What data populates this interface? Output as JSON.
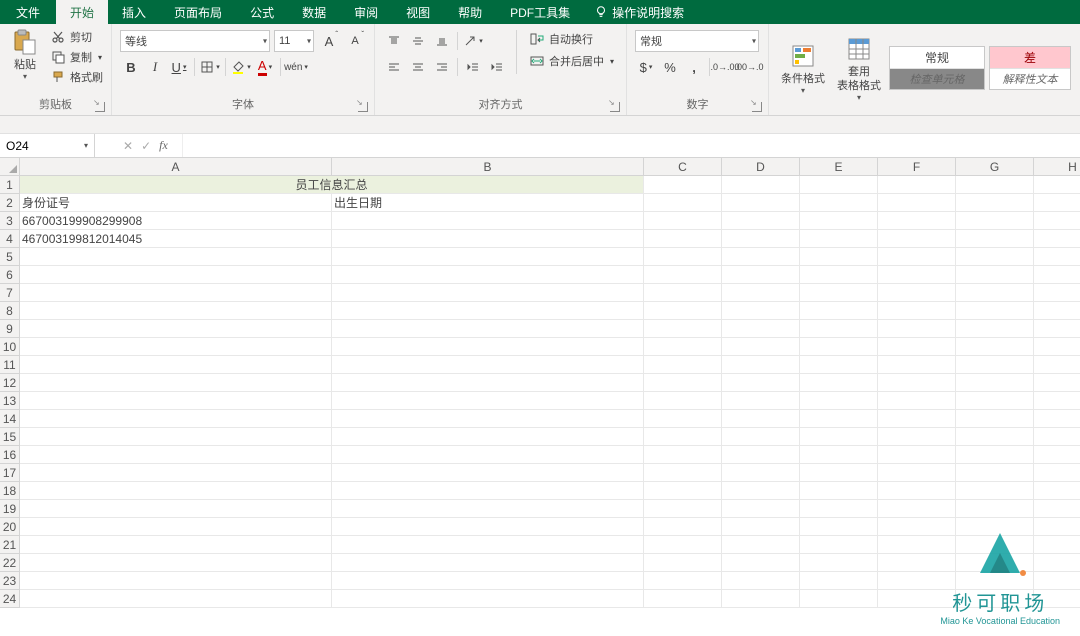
{
  "tabs": {
    "file": "文件",
    "home": "开始",
    "insert": "插入",
    "layout": "页面布局",
    "formulas": "公式",
    "data": "数据",
    "review": "审阅",
    "view": "视图",
    "help": "帮助",
    "pdf": "PDF工具集",
    "tell": "操作说明搜索"
  },
  "ribbon": {
    "clipboard": {
      "paste": "粘贴",
      "cut": "剪切",
      "copy": "复制",
      "painter": "格式刷",
      "label": "剪贴板"
    },
    "font": {
      "name": "等线",
      "size": "11",
      "label": "字体"
    },
    "align": {
      "wrap": "自动换行",
      "merge": "合并后居中",
      "label": "对齐方式"
    },
    "number": {
      "format": "常规",
      "label": "数字"
    },
    "styles": {
      "cond": "条件格式",
      "table": "套用\n表格格式",
      "normal": "常规",
      "check": "检查单元格",
      "bad": "差",
      "explain": "解释性文本"
    }
  },
  "fxbar": {
    "namebox": "O24"
  },
  "sheet": {
    "cols": [
      "A",
      "B",
      "C",
      "D",
      "E",
      "F",
      "G",
      "H"
    ],
    "title": "员工信息汇总",
    "a2": "身份证号",
    "b2": "出生日期",
    "a3": "667003199908299908",
    "a4": "467003199812014045",
    "rowcount": 24
  },
  "watermark": {
    "line1": "秒可职场",
    "line2": "Miao Ke Vocational Education"
  }
}
